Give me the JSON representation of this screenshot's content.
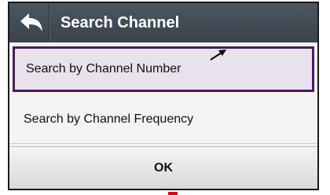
{
  "header": {
    "title": "Search Channel",
    "back_icon": "back-arrow-icon"
  },
  "options": [
    {
      "label": "Search by Channel Number",
      "selected": true
    },
    {
      "label": "Search by Channel Frequency",
      "selected": false
    }
  ],
  "footer": {
    "ok_label": "OK"
  },
  "colors": {
    "titlebar": "#434c55",
    "selected_border": "#4a1b5e",
    "selected_fill": "#e7e2ec"
  }
}
